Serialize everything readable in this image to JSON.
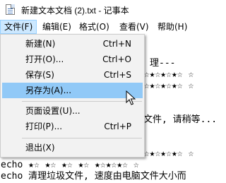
{
  "window": {
    "title": "新建文本文档 (2).txt - 记事本"
  },
  "menubar": {
    "items": [
      {
        "label": "文件(F)"
      },
      {
        "label": "编辑(E)"
      },
      {
        "label": "格式(O)"
      },
      {
        "label": "查看(V)"
      },
      {
        "label": "帮助(H)"
      }
    ]
  },
  "file_menu": {
    "items": [
      {
        "label": "新建(N)",
        "shortcut": "Ctrl+N"
      },
      {
        "label": "打开(O)...",
        "shortcut": "Ctrl+O"
      },
      {
        "label": "保存(S)",
        "shortcut": "Ctrl+S"
      },
      {
        "label": "另存为(A)...",
        "shortcut": ""
      },
      {
        "label": "页面设置(U)...",
        "shortcut": ""
      },
      {
        "label": "打印(P)...",
        "shortcut": "Ctrl+P"
      },
      {
        "label": "退出(X)",
        "shortcut": ""
      }
    ],
    "highlighted": "另存为(A)..."
  },
  "editor": {
    "visible_fragments": [
      "理---",
      "★☆★☆★☆★☆ ☆",
      "★☆★☆★☆★☆ ☆",
      "文件, 请稍等...",
      "★☆★☆★☆★☆ ☆",
      "echo ★☆ ★☆ ★☆ ★☆ ★☆★☆★☆ ☆",
      "echo 清理垃圾文件, 速度由电脑文件大小而"
    ]
  }
}
